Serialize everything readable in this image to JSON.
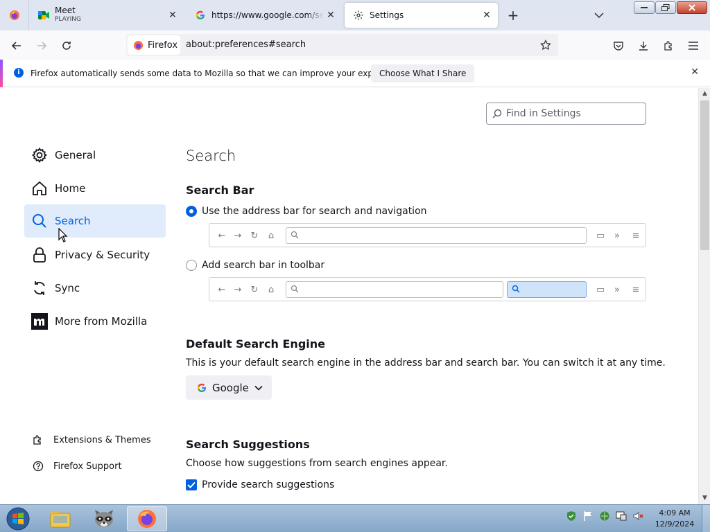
{
  "tabs": [
    {
      "title": "Meet",
      "subtitle": "PLAYING"
    },
    {
      "title": "https://www.google.com/search"
    },
    {
      "title": "Settings"
    }
  ],
  "navbar": {
    "identity_label": "Firefox",
    "url": "about:preferences#search"
  },
  "notification": {
    "message": "Firefox automatically sends some data to Mozilla so that we can improve your experience.",
    "button": "Choose What I Share"
  },
  "find": {
    "placeholder": "Find in Settings"
  },
  "sidebar": {
    "items": [
      {
        "label": "General",
        "icon": "gear-icon"
      },
      {
        "label": "Home",
        "icon": "home-icon"
      },
      {
        "label": "Search",
        "icon": "search-icon",
        "selected": true
      },
      {
        "label": "Privacy & Security",
        "icon": "lock-icon"
      },
      {
        "label": "Sync",
        "icon": "sync-icon"
      },
      {
        "label": "More from Mozilla",
        "icon": "mozilla-icon"
      }
    ],
    "footer": [
      {
        "label": "Extensions & Themes",
        "icon": "puzzle-icon"
      },
      {
        "label": "Firefox Support",
        "icon": "help-icon"
      }
    ]
  },
  "main": {
    "title": "Search",
    "search_bar": {
      "heading": "Search Bar",
      "option_address": "Use the address bar for search and navigation",
      "option_toolbar": "Add search bar in toolbar",
      "selected": "address"
    },
    "default_engine": {
      "heading": "Default Search Engine",
      "description": "This is your default search engine in the address bar and search bar. You can switch it at any time.",
      "engine": "Google"
    },
    "suggestions": {
      "heading": "Search Suggestions",
      "description": "Choose how suggestions from search engines appear.",
      "checkbox_label": "Provide search suggestions",
      "checked": true
    }
  },
  "taskbar": {
    "time": "4:09 AM",
    "date": "12/9/2024"
  },
  "colors": {
    "accent": "#0061e0",
    "selected_bg": "#e0ecfb"
  }
}
